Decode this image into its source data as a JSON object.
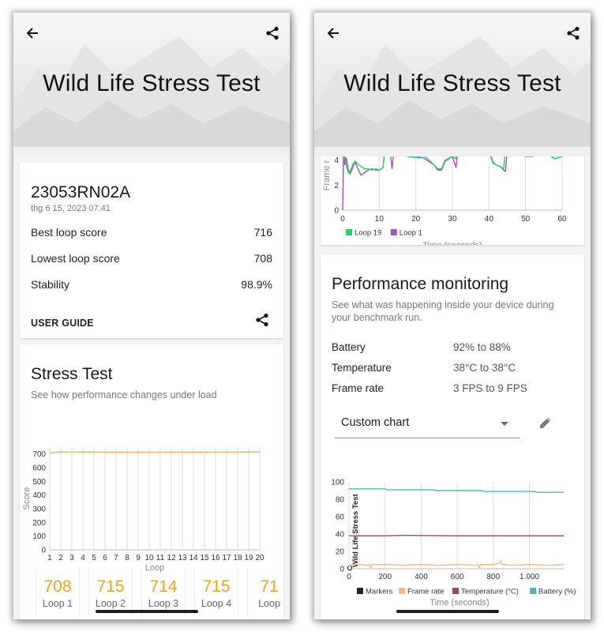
{
  "left_screen": {
    "header": {
      "title": "Wild Life Stress Test",
      "back_icon": "arrow-left-icon",
      "share_icon": "share-icon"
    },
    "summary": {
      "device": "23053RN02A",
      "date": "thg 6 15, 2023 07:41",
      "rows": [
        {
          "label": "Best loop score",
          "value": "716"
        },
        {
          "label": "Lowest loop score",
          "value": "708"
        },
        {
          "label": "Stability",
          "value": "98.9%"
        }
      ],
      "user_guide": "USER GUIDE"
    },
    "stress_test": {
      "title": "Stress Test",
      "subtitle": "See how performance changes under load",
      "loops": [
        {
          "score": "708",
          "label": "Loop 1"
        },
        {
          "score": "715",
          "label": "Loop 2"
        },
        {
          "score": "714",
          "label": "Loop 3"
        },
        {
          "score": "715",
          "label": "Loop 4"
        },
        {
          "score": "71",
          "label": "Loop"
        }
      ]
    }
  },
  "right_screen": {
    "header": {
      "title": "Wild Life Stress Test",
      "back_icon": "arrow-left-icon",
      "share_icon": "share-icon"
    },
    "performance": {
      "title": "Performance monitoring",
      "subtitle_line1": "See what was happening inside your device during",
      "subtitle_line2": "your benchmark run.",
      "metrics": [
        {
          "label": "Battery",
          "value": "92% to 88%"
        },
        {
          "label": "Temperature",
          "value": "38°C to 38°C"
        },
        {
          "label": "Frame rate",
          "value": "3 FPS to 9 FPS"
        }
      ],
      "dropdown_value": "Custom chart",
      "edit_icon": "pencil-icon"
    }
  },
  "chart_data": [
    {
      "id": "stress",
      "type": "line",
      "title": "",
      "xlabel": "Loop",
      "ylabel": "Score",
      "categories": [
        "1",
        "2",
        "3",
        "4",
        "5",
        "6",
        "7",
        "8",
        "9",
        "10",
        "11",
        "12",
        "13",
        "14",
        "15",
        "16",
        "17",
        "18",
        "19",
        "20"
      ],
      "ylim": [
        0,
        750
      ],
      "yticks": [
        0,
        100,
        200,
        300,
        400,
        500,
        600,
        700
      ],
      "grid": "vertical",
      "color": "#f4b98a",
      "series": [
        {
          "name": "Score",
          "values": [
            708,
            715,
            714,
            715,
            714,
            714,
            714,
            714,
            713,
            713,
            714,
            714,
            714,
            714,
            714,
            714,
            714,
            714,
            716,
            715
          ]
        }
      ]
    },
    {
      "id": "framerate",
      "type": "line",
      "xlabel": "Time (seconds)",
      "ylabel": "Frame r",
      "xlim": [
        0,
        60
      ],
      "xticks": [
        0,
        10,
        20,
        30,
        40,
        50,
        60
      ],
      "yticks": [
        0,
        2,
        4
      ],
      "ylim": [
        0,
        4.8
      ],
      "legend": "bottom-left",
      "grid": "vertical",
      "series": [
        {
          "name": "Loop 19",
          "color": "#2ecc71",
          "x": [
            0.3,
            0.6,
            1,
            1.5,
            2,
            2.5,
            3,
            3.5,
            4,
            5,
            6,
            7,
            8,
            9,
            10,
            11,
            11.5,
            12,
            13,
            13.5,
            14,
            15,
            16,
            18,
            20,
            22,
            24,
            25,
            26,
            27,
            28,
            30,
            31,
            31.5,
            32,
            34,
            35,
            40,
            41,
            42,
            43,
            44,
            44.5,
            45,
            46,
            48,
            50,
            52,
            54,
            56,
            58,
            60
          ],
          "y": [
            4.6,
            4.2,
            3.6,
            3.0,
            3.1,
            3.4,
            3.8,
            3.9,
            3.7,
            3.5,
            3.3,
            3.3,
            3.2,
            3.3,
            3.2,
            3.4,
            4.7,
            4.8,
            4.8,
            4.7,
            4.7,
            4.5,
            4.4,
            4.3,
            4.2,
            4.4,
            3.9,
            3.6,
            3.3,
            3.3,
            4.0,
            4.3,
            4.1,
            4.9,
            4.9,
            4.9,
            4.9,
            4.9,
            3.9,
            3.6,
            3.5,
            3.3,
            4.9,
            4.9,
            4.9,
            4.7,
            4.3,
            4.4,
            4.8,
            4.5,
            4.1,
            4.3
          ]
        },
        {
          "name": "Loop 1",
          "color": "#9b59b6",
          "x": [
            0,
            0.3,
            0.6,
            1,
            1.5,
            2,
            2.5,
            3,
            3.5,
            4,
            5,
            6,
            7,
            8,
            9,
            10,
            11,
            11.5,
            12,
            13,
            13.5,
            14,
            15,
            16,
            18,
            20,
            22,
            24,
            25,
            26,
            27,
            28,
            30,
            31,
            31.5,
            32,
            40,
            41,
            42,
            43,
            44,
            44.5,
            45,
            46,
            48,
            50,
            52,
            54,
            56,
            58,
            60
          ],
          "y": [
            0,
            4.8,
            3.6,
            4.2,
            3.3,
            2.9,
            3.2,
            3.6,
            3.8,
            3.4,
            2.8,
            3.0,
            3.2,
            3.3,
            3.2,
            3.2,
            3.4,
            4.7,
            4.8,
            4.7,
            3.3,
            4.7,
            4.4,
            4.4,
            4.3,
            4.2,
            4.2,
            3.8,
            3.6,
            3.2,
            3.2,
            3.9,
            4.3,
            3.4,
            4.9,
            4.9,
            4.8,
            3.8,
            3.6,
            3.5,
            3.2,
            3.1,
            4.9,
            4.9,
            4.7,
            4.3,
            4.3,
            4.8,
            4.5,
            4.1,
            4.3
          ]
        }
      ]
    },
    {
      "id": "custom",
      "type": "line",
      "xlabel": "Time (seconds)",
      "xlim": [
        0,
        1190
      ],
      "xticks": [
        0,
        200,
        400,
        600,
        800,
        1000
      ],
      "xtick_labels": [
        "0",
        "200",
        "400",
        "600",
        "800",
        "1.000"
      ],
      "ylim": [
        0,
        100
      ],
      "yticks": [
        0,
        20,
        40,
        60,
        80,
        100
      ],
      "grid": "vertical",
      "marker_label": "Wild Life Stress Test",
      "legend": [
        "Markers",
        "Frame rate",
        "Temperature (°C)",
        "Battery (%)"
      ],
      "series": [
        {
          "name": "Markers",
          "color": "#222222",
          "x": [
            0
          ],
          "y": [
            0
          ]
        },
        {
          "name": "Frame rate",
          "color": "#f4b98a",
          "x": [
            0,
            20,
            60,
            100,
            115,
            120,
            130,
            200,
            300,
            400,
            500,
            600,
            700,
            715,
            720,
            730,
            800,
            835,
            840,
            850,
            900,
            1000,
            1100,
            1190
          ],
          "y": [
            3,
            5,
            5,
            4,
            5,
            1,
            5,
            5,
            4,
            5,
            4,
            5,
            4,
            5,
            1,
            5,
            5,
            6,
            9,
            5,
            4,
            5,
            4,
            5
          ]
        },
        {
          "name": "Temperature (°C)",
          "color": "#9c4a5a",
          "x": [
            0,
            200,
            300,
            600,
            1190
          ],
          "y": [
            38,
            38,
            38.5,
            38,
            38
          ]
        },
        {
          "name": "Battery (%)",
          "color": "#4fb9b9",
          "x": [
            0,
            200,
            210,
            470,
            480,
            740,
            750,
            1030,
            1040,
            1190
          ],
          "y": [
            92,
            92,
            91,
            91,
            90,
            90,
            89,
            89,
            88,
            88
          ]
        }
      ]
    }
  ]
}
